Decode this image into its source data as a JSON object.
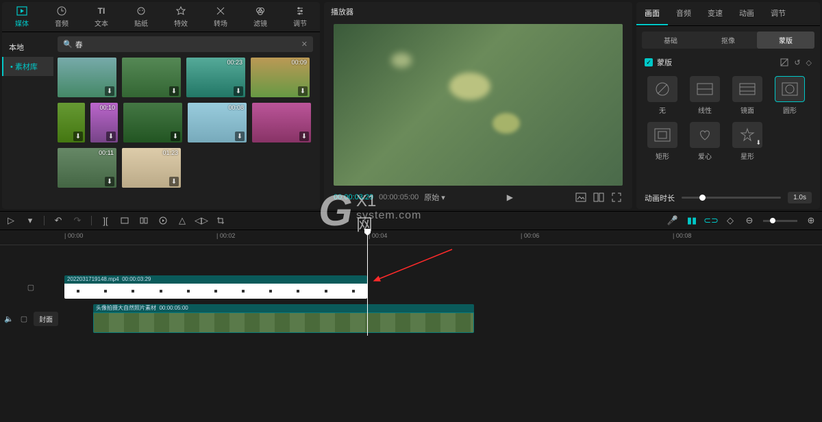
{
  "media_tabs": [
    {
      "label": "媒体",
      "icon": "media"
    },
    {
      "label": "音频",
      "icon": "audio"
    },
    {
      "label": "文本",
      "icon": "text"
    },
    {
      "label": "贴纸",
      "icon": "sticker"
    },
    {
      "label": "特效",
      "icon": "fx"
    },
    {
      "label": "转场",
      "icon": "transition"
    },
    {
      "label": "滤镜",
      "icon": "filter"
    },
    {
      "label": "调节",
      "icon": "adjust"
    }
  ],
  "sidebar": {
    "items": [
      "本地",
      "素材库"
    ],
    "active_index": 1
  },
  "search": {
    "value": "春"
  },
  "thumbnails": {
    "durations": [
      "",
      "",
      "00:23",
      "00:09",
      "",
      "00:10",
      "",
      "00:08",
      "",
      "00:11",
      "01:23"
    ]
  },
  "player": {
    "title": "播放器",
    "current_time": "00:00:03:29",
    "total_time": "00:00:05:00",
    "ratio_label": "原始"
  },
  "props": {
    "tabs": [
      "画面",
      "音频",
      "变速",
      "动画",
      "调节"
    ],
    "active_tab": 0,
    "subtabs": [
      "基础",
      "抠像",
      "蒙版"
    ],
    "active_subtab": 2,
    "mask_label": "蒙版",
    "masks": [
      {
        "name": "无"
      },
      {
        "name": "线性"
      },
      {
        "name": "镜面"
      },
      {
        "name": "圆形"
      },
      {
        "name": "矩形"
      },
      {
        "name": "爱心"
      },
      {
        "name": "星形"
      }
    ],
    "active_mask": 3,
    "anim_label": "动画时长",
    "anim_value": "1.0s"
  },
  "ruler": {
    "ticks": [
      "00:00",
      "00:02",
      "00:04",
      "00:06",
      "00:08"
    ]
  },
  "clips": {
    "top": {
      "name": "2022031719148.mp4",
      "dur": "00:00:03:29"
    },
    "bottom": {
      "name": "头像拍摄大自然照片素材",
      "dur": "00:00:05:00"
    }
  },
  "cover_btn": "封面",
  "watermark": {
    "big": "G",
    "top": "X1网",
    "bottom": "system.com"
  }
}
